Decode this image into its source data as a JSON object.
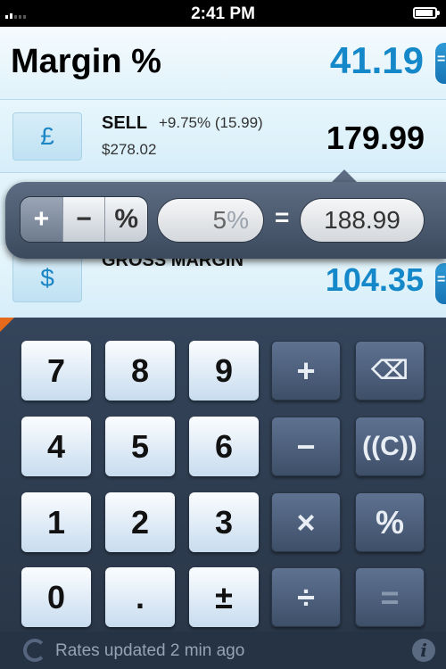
{
  "status": {
    "time": "2:41 PM"
  },
  "margin": {
    "label": "Margin %",
    "value": "41.19"
  },
  "sell": {
    "currency": "£",
    "name": "SELL",
    "change": "+9.75% (15.99)",
    "amount": "$278.02",
    "value": "179.99"
  },
  "popover": {
    "plus": "+",
    "minus": "−",
    "percent": "%",
    "input_value": "5",
    "input_unit": "%",
    "equals": "=",
    "result": "188.99"
  },
  "gross": {
    "currency": "$",
    "name": "GROSS MARGIN",
    "value": "104.35"
  },
  "keys": {
    "k7": "7",
    "k8": "8",
    "k9": "9",
    "plus": "+",
    "backspace": "⌫",
    "k4": "4",
    "k5": "5",
    "k6": "6",
    "minus": "−",
    "clear": "((C))",
    "k1": "1",
    "k2": "2",
    "k3": "3",
    "multiply": "×",
    "percent": "%",
    "k0": "0",
    "dot": ".",
    "plusminus": "±",
    "divide": "÷",
    "equals": "="
  },
  "footer": {
    "text": "Rates updated 2 min ago",
    "info": "i"
  },
  "colors": {
    "accent": "#1588c9",
    "keypad_bg": "#34445a",
    "corner": "#e56a1c"
  }
}
